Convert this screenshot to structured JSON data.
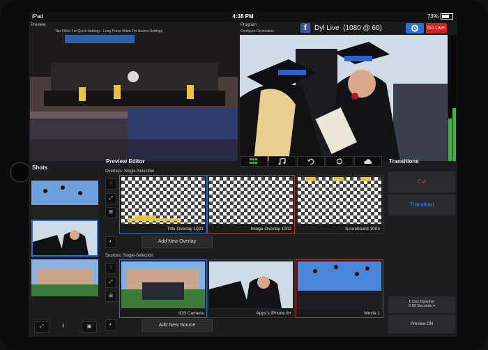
{
  "status_bar": {
    "device": "iPad",
    "time": "4:38 PM",
    "battery": "73%"
  },
  "preview": {
    "label": "Preview",
    "hint": "Tap Video For Quick Settings · Long Press Video For Source Settings"
  },
  "program": {
    "label": "Program",
    "hint": "Configure Destination"
  },
  "destination": {
    "name": "Dyl Live",
    "format": "(1080 @ 60)",
    "go_live": "Go Live!",
    "brand_letter": "f"
  },
  "shots": {
    "title": "Shots",
    "count": "3"
  },
  "editor": {
    "title": "Preview Editor",
    "overlays_label": "Overlays:  Single-Selection",
    "sources_label": "Sources:  Single-Selection",
    "add_overlay": "Add New Overlay",
    "add_source": "Add New Source",
    "overlays": [
      {
        "name": "Title Overlay 1001"
      },
      {
        "name": "Image Overlay 1002"
      },
      {
        "name": "Scoreboard 1003"
      }
    ],
    "sources": [
      {
        "name": "iOS Camera"
      },
      {
        "name": "Apps's iPhone 6+"
      },
      {
        "name": "Movie 1"
      }
    ]
  },
  "transitions": {
    "title": "Transitions",
    "cut": "Cut",
    "transition": "Transition",
    "type": "Cross Dissolve",
    "duration": "0.50 Seconds ▾",
    "preview_on": "Preview ON"
  },
  "colors": {
    "accent_blue": "#2c6fdc",
    "live_red": "#d21f1f",
    "meter_green": "#2fbf35",
    "cut_red": "#d83a2e",
    "transition_blue": "#3d8ef0"
  }
}
